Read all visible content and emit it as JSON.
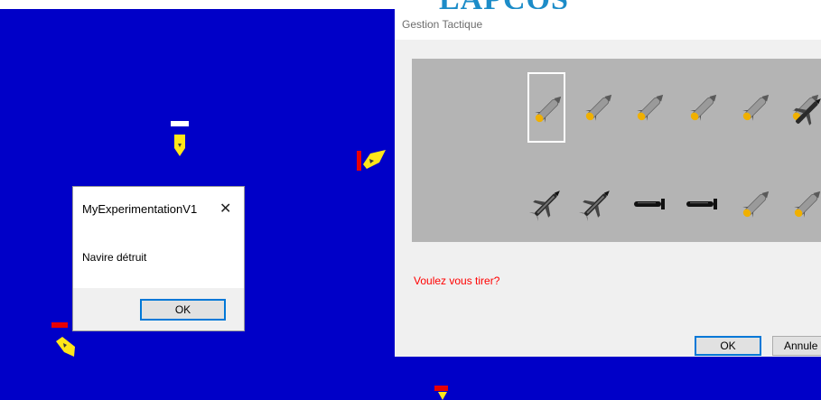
{
  "banner": {
    "text": "LAPCOS"
  },
  "colors": {
    "sea": "#0000c8",
    "ship": "#ffe619",
    "health_full": "#ffffff",
    "health_low": "#e80000",
    "warning_text": "#ff0000",
    "focus_border": "#0078d7"
  },
  "tactical_window": {
    "title": "Gestion Tactique",
    "weapons_row1": [
      "missile-icon",
      "missile-icon",
      "missile-icon",
      "missile-icon",
      "missile-icon",
      "missile-icon",
      "cruise-missile-icon"
    ],
    "weapons_row2": [
      "cruise-missile-icon",
      "cruise-missile-icon",
      "torpedo-icon",
      "torpedo-icon",
      "missile-icon",
      "missile-icon"
    ],
    "selected_weapon_index": 0,
    "question": "Voulez vous tirer?",
    "ok_label": "OK",
    "cancel_label": "Annule"
  },
  "message_box": {
    "title": "MyExperimentationV1",
    "close_glyph": "✕",
    "message": "Navire détruit",
    "ok_label": "OK"
  },
  "ships": [
    {
      "name": "ship-north",
      "health_color": "#ffffff"
    },
    {
      "name": "ship-east",
      "health_color": "#e80000"
    },
    {
      "name": "ship-southwest",
      "health_color": "#e80000"
    },
    {
      "name": "ship-south",
      "health_color": "#e80000"
    }
  ]
}
